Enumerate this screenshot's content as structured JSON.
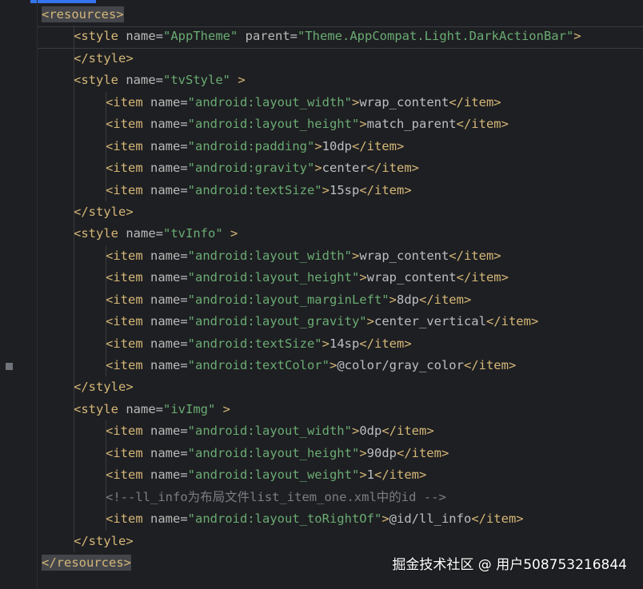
{
  "editor": {
    "lines": [
      {
        "indent": 0,
        "parts": [
          [
            "tag",
            "<resources>"
          ]
        ],
        "highlighted": true
      },
      {
        "indent": 1,
        "parts": [
          [
            "tag",
            "<style "
          ],
          [
            "attr",
            "name"
          ],
          [
            "txt",
            "="
          ],
          [
            "val",
            "\"AppTheme\""
          ],
          [
            "txt",
            " "
          ],
          [
            "attr",
            "parent"
          ],
          [
            "txt",
            "="
          ],
          [
            "val",
            "\"Theme.AppCompat.Light.DarkActionBar\""
          ],
          [
            "tag",
            ">"
          ]
        ]
      },
      {
        "indent": 1,
        "parts": [
          [
            "tag",
            "</style>"
          ]
        ]
      },
      {
        "indent": 1,
        "parts": [
          [
            "tag",
            "<style "
          ],
          [
            "attr",
            "name"
          ],
          [
            "txt",
            "="
          ],
          [
            "val",
            "\"tvStyle\""
          ],
          [
            "txt",
            " "
          ],
          [
            "tag",
            ">"
          ]
        ]
      },
      {
        "indent": 2,
        "parts": [
          [
            "tag",
            "<item "
          ],
          [
            "attr",
            "name"
          ],
          [
            "txt",
            "="
          ],
          [
            "val",
            "\"android:layout_width\""
          ],
          [
            "tag",
            ">"
          ],
          [
            "txt",
            "wrap_content"
          ],
          [
            "tag",
            "</item>"
          ]
        ]
      },
      {
        "indent": 2,
        "parts": [
          [
            "tag",
            "<item "
          ],
          [
            "attr",
            "name"
          ],
          [
            "txt",
            "="
          ],
          [
            "val",
            "\"android:layout_height\""
          ],
          [
            "tag",
            ">"
          ],
          [
            "txt",
            "match_parent"
          ],
          [
            "tag",
            "</item>"
          ]
        ]
      },
      {
        "indent": 2,
        "parts": [
          [
            "tag",
            "<item "
          ],
          [
            "attr",
            "name"
          ],
          [
            "txt",
            "="
          ],
          [
            "val",
            "\"android:padding\""
          ],
          [
            "tag",
            ">"
          ],
          [
            "txt",
            "10dp"
          ],
          [
            "tag",
            "</item>"
          ]
        ]
      },
      {
        "indent": 2,
        "parts": [
          [
            "tag",
            "<item "
          ],
          [
            "attr",
            "name"
          ],
          [
            "txt",
            "="
          ],
          [
            "val",
            "\"android:gravity\""
          ],
          [
            "tag",
            ">"
          ],
          [
            "txt",
            "center"
          ],
          [
            "tag",
            "</item>"
          ]
        ]
      },
      {
        "indent": 2,
        "parts": [
          [
            "tag",
            "<item "
          ],
          [
            "attr",
            "name"
          ],
          [
            "txt",
            "="
          ],
          [
            "val",
            "\"android:textSize\""
          ],
          [
            "tag",
            ">"
          ],
          [
            "txt",
            "15sp"
          ],
          [
            "tag",
            "</item>"
          ]
        ]
      },
      {
        "indent": 1,
        "parts": [
          [
            "tag",
            "</style>"
          ]
        ]
      },
      {
        "indent": 1,
        "parts": [
          [
            "tag",
            "<style "
          ],
          [
            "attr",
            "name"
          ],
          [
            "txt",
            "="
          ],
          [
            "val",
            "\"tvInfo\""
          ],
          [
            "txt",
            " "
          ],
          [
            "tag",
            ">"
          ]
        ]
      },
      {
        "indent": 2,
        "parts": [
          [
            "tag",
            "<item "
          ],
          [
            "attr",
            "name"
          ],
          [
            "txt",
            "="
          ],
          [
            "val",
            "\"android:layout_width\""
          ],
          [
            "tag",
            ">"
          ],
          [
            "txt",
            "wrap_content"
          ],
          [
            "tag",
            "</item>"
          ]
        ]
      },
      {
        "indent": 2,
        "parts": [
          [
            "tag",
            "<item "
          ],
          [
            "attr",
            "name"
          ],
          [
            "txt",
            "="
          ],
          [
            "val",
            "\"android:layout_height\""
          ],
          [
            "tag",
            ">"
          ],
          [
            "txt",
            "wrap_content"
          ],
          [
            "tag",
            "</item>"
          ]
        ]
      },
      {
        "indent": 2,
        "parts": [
          [
            "tag",
            "<item "
          ],
          [
            "attr",
            "name"
          ],
          [
            "txt",
            "="
          ],
          [
            "val",
            "\"android:layout_marginLeft\""
          ],
          [
            "tag",
            ">"
          ],
          [
            "txt",
            "8dp"
          ],
          [
            "tag",
            "</item>"
          ]
        ]
      },
      {
        "indent": 2,
        "parts": [
          [
            "tag",
            "<item "
          ],
          [
            "attr",
            "name"
          ],
          [
            "txt",
            "="
          ],
          [
            "val",
            "\"android:layout_gravity\""
          ],
          [
            "tag",
            ">"
          ],
          [
            "txt",
            "center_vertical"
          ],
          [
            "tag",
            "</item>"
          ]
        ]
      },
      {
        "indent": 2,
        "parts": [
          [
            "tag",
            "<item "
          ],
          [
            "attr",
            "name"
          ],
          [
            "txt",
            "="
          ],
          [
            "val",
            "\"android:textSize\""
          ],
          [
            "tag",
            ">"
          ],
          [
            "txt",
            "14sp"
          ],
          [
            "tag",
            "</item>"
          ]
        ]
      },
      {
        "indent": 2,
        "parts": [
          [
            "tag",
            "<item "
          ],
          [
            "attr",
            "name"
          ],
          [
            "txt",
            "="
          ],
          [
            "val",
            "\"android:textColor\""
          ],
          [
            "tag",
            ">"
          ],
          [
            "txt",
            "@color/gray_color"
          ],
          [
            "tag",
            "</item>"
          ]
        ]
      },
      {
        "indent": 1,
        "parts": [
          [
            "tag",
            "</style>"
          ]
        ]
      },
      {
        "indent": 1,
        "parts": [
          [
            "tag",
            "<style "
          ],
          [
            "attr",
            "name"
          ],
          [
            "txt",
            "="
          ],
          [
            "val",
            "\"ivImg\""
          ],
          [
            "txt",
            " "
          ],
          [
            "tag",
            ">"
          ]
        ]
      },
      {
        "indent": 2,
        "parts": [
          [
            "tag",
            "<item "
          ],
          [
            "attr",
            "name"
          ],
          [
            "txt",
            "="
          ],
          [
            "val",
            "\"android:layout_width\""
          ],
          [
            "tag",
            ">"
          ],
          [
            "txt",
            "0dp"
          ],
          [
            "tag",
            "</item>"
          ]
        ]
      },
      {
        "indent": 2,
        "parts": [
          [
            "tag",
            "<item "
          ],
          [
            "attr",
            "name"
          ],
          [
            "txt",
            "="
          ],
          [
            "val",
            "\"android:layout_height\""
          ],
          [
            "tag",
            ">"
          ],
          [
            "txt",
            "90dp"
          ],
          [
            "tag",
            "</item>"
          ]
        ]
      },
      {
        "indent": 2,
        "parts": [
          [
            "tag",
            "<item "
          ],
          [
            "attr",
            "name"
          ],
          [
            "txt",
            "="
          ],
          [
            "val",
            "\"android:layout_weight\""
          ],
          [
            "tag",
            ">"
          ],
          [
            "txt",
            "1"
          ],
          [
            "tag",
            "</item>"
          ]
        ]
      },
      {
        "indent": 2,
        "parts": [
          [
            "comment",
            "<!--ll_info为布局文件list_item_one.xml中的id -->"
          ]
        ]
      },
      {
        "indent": 2,
        "parts": [
          [
            "tag",
            "<item "
          ],
          [
            "attr",
            "name"
          ],
          [
            "txt",
            "="
          ],
          [
            "val",
            "\"android:layout_toRightOf\""
          ],
          [
            "tag",
            ">"
          ],
          [
            "txt",
            "@id/ll_info"
          ],
          [
            "tag",
            "</item>"
          ]
        ]
      },
      {
        "indent": 1,
        "parts": [
          [
            "tag",
            "</style>"
          ]
        ]
      },
      {
        "indent": 0,
        "parts": [
          [
            "tag",
            "</resources>"
          ]
        ],
        "highlighted": true
      }
    ]
  },
  "watermark": {
    "text": "掘金技术社区 @ 用户508753216844"
  },
  "colors": {
    "background": "#1e1f22",
    "tag": "#d5b778",
    "attribute": "#bababa",
    "string": "#6aab73",
    "text": "#bcbec4",
    "comment": "#7a7e85",
    "accent": "#3574f0"
  }
}
